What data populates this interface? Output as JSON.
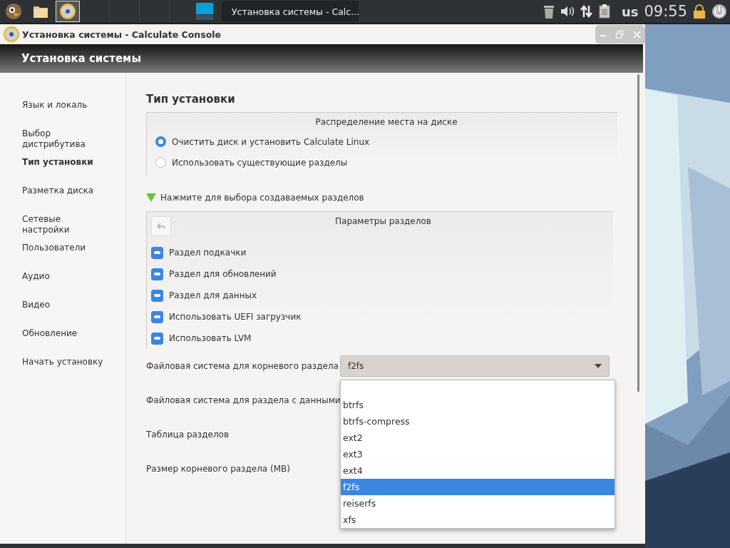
{
  "taskbar": {
    "launchers": [
      {
        "kind": "mascot",
        "selected": false
      },
      {
        "kind": "folder",
        "selected": false
      },
      {
        "kind": "disc",
        "selected": true
      }
    ],
    "task": {
      "title": "Установка системы - Calc..."
    },
    "tray": {
      "layout": "us",
      "clock": "09:55"
    }
  },
  "window": {
    "title": "Установка системы - Calculate Console",
    "header": "Установка системы"
  },
  "sidebar": {
    "items": [
      {
        "label": "Язык и локаль",
        "selected": false
      },
      {
        "label": "Выбор\nдистрибутива",
        "selected": false
      },
      {
        "label": "Тип установки",
        "selected": true
      },
      {
        "label": "Разметка диска",
        "selected": false
      },
      {
        "label": "Сетевые\nнастройки",
        "selected": false
      },
      {
        "label": "Пользователи",
        "selected": false
      },
      {
        "label": "Аудио",
        "selected": false
      },
      {
        "label": "Видео",
        "selected": false
      },
      {
        "label": "Обновление",
        "selected": false
      },
      {
        "label": "Начать установку",
        "selected": false
      }
    ]
  },
  "section_title": "Тип установки",
  "disk_allocation": {
    "title": "Распределение места на диске",
    "options": [
      {
        "label": "Очистить диск и установить Calculate Linux",
        "selected": true
      },
      {
        "label": "Использовать существующие разделы",
        "selected": false
      }
    ]
  },
  "expander": {
    "label": "Нажмите для выбора создаваемых разделов",
    "expanded": true
  },
  "partition_params": {
    "title": "Параметры разделов",
    "options": [
      {
        "label": "Раздел подкачки",
        "checked": true
      },
      {
        "label": "Раздел для обновлений",
        "checked": true
      },
      {
        "label": "Раздел для данных",
        "checked": true
      },
      {
        "label": "Использовать UEFI загрузчик",
        "checked": true
      },
      {
        "label": "Использовать LVM",
        "checked": true
      }
    ]
  },
  "fields": [
    {
      "label": "Файловая система для корневого раздела",
      "value": "f2fs",
      "open": true,
      "options": [
        {
          "label": "btrfs",
          "selected": false
        },
        {
          "label": "btrfs-compress",
          "selected": false
        },
        {
          "label": "ext2",
          "selected": false
        },
        {
          "label": "ext3",
          "selected": false
        },
        {
          "label": "ext4",
          "selected": false
        },
        {
          "label": "f2fs",
          "selected": true
        },
        {
          "label": "reiserfs",
          "selected": false
        },
        {
          "label": "xfs",
          "selected": false
        }
      ]
    },
    {
      "label": "Файловая система для раздела с данными"
    },
    {
      "label": "Таблица разделов"
    },
    {
      "label": "Размер корневого раздела (MB)"
    }
  ]
}
